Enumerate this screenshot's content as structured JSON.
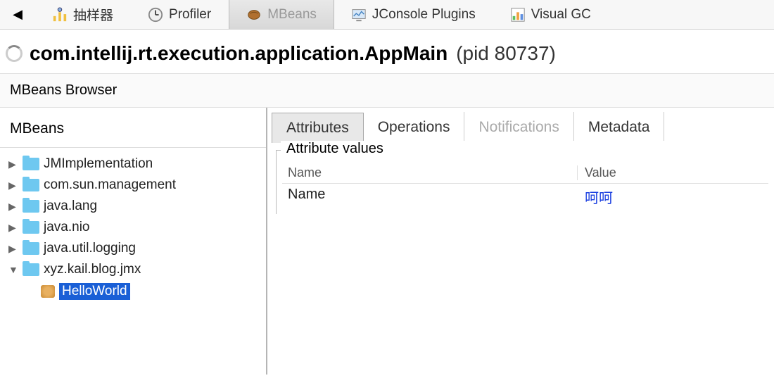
{
  "top_tabs": {
    "sampler": "抽样器",
    "profiler": "Profiler",
    "mbeans": "MBeans",
    "jconsole_plugins": "JConsole Plugins",
    "visual_gc": "Visual GC"
  },
  "header": {
    "title": "com.intellij.rt.execution.application.AppMain",
    "pid": "(pid 80737)"
  },
  "browser_label": "MBeans Browser",
  "left": {
    "header": "MBeans",
    "tree": [
      {
        "label": "JMImplementation",
        "expanded": false
      },
      {
        "label": "com.sun.management",
        "expanded": false
      },
      {
        "label": "java.lang",
        "expanded": false
      },
      {
        "label": "java.nio",
        "expanded": false
      },
      {
        "label": "java.util.logging",
        "expanded": false
      },
      {
        "label": "xyz.kail.blog.jmx",
        "expanded": true
      }
    ],
    "selected_bean": "HelloWorld"
  },
  "detail_tabs": {
    "attributes": "Attributes",
    "operations": "Operations",
    "notifications": "Notifications",
    "metadata": "Metadata"
  },
  "attributes": {
    "legend": "Attribute values",
    "header_name": "Name",
    "header_value": "Value",
    "rows": [
      {
        "name": "Name",
        "value": "呵呵"
      }
    ]
  }
}
